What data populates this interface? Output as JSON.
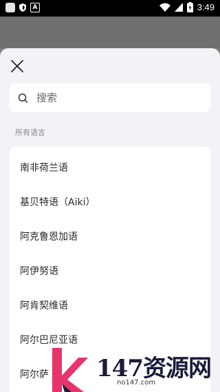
{
  "status_bar": {
    "time": "3:49",
    "icons": [
      "app-square-icon",
      "shield-icon",
      "a-badge-icon",
      "wifi-icon",
      "signal-icon",
      "battery-charging-icon"
    ]
  },
  "sheet": {
    "close_icon": "close-icon",
    "search": {
      "placeholder": "搜索",
      "value": ""
    },
    "section_label": "所有语言",
    "languages": [
      "南非荷兰语",
      "基贝特语（Aiki）",
      "阿克鲁恩加语",
      "阿伊努语",
      "阿肯契维语",
      "阿尔巴尼亚语",
      "阿尔萨"
    ]
  },
  "watermark": {
    "text": "147资源网",
    "url": "no147.com"
  },
  "colors": {
    "sheet_bg": "#f3f3f7",
    "card_bg": "#ffffff",
    "backdrop": "#7f7f7f",
    "logo_pink": "#e8336b",
    "logo_navy": "#1b1b3c"
  }
}
